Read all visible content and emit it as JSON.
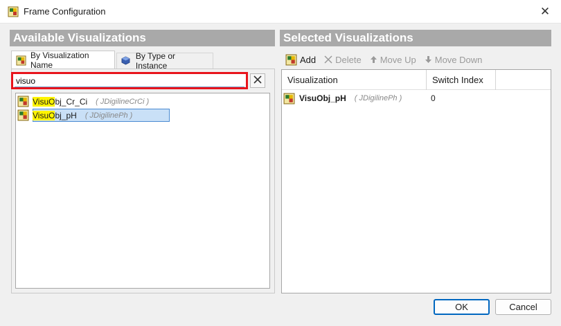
{
  "window": {
    "title": "Frame Configuration",
    "close_glyph": "✕"
  },
  "left_panel": {
    "header": "Available Visualizations",
    "tabs": [
      {
        "label": "By Visualization Name",
        "icon": "visu-object-icon",
        "active": true
      },
      {
        "label": "By Type or Instance",
        "icon": "cube-icon",
        "active": false
      }
    ],
    "search": {
      "value": "visuo",
      "placeholder": "",
      "clear_icon": "clear-x-icon"
    },
    "items": [
      {
        "match": "VisuO",
        "rest": "bj_Cr_Ci",
        "type": "( JDigilineCrCi )",
        "selected": false
      },
      {
        "match": "VisuO",
        "rest": "bj_pH",
        "type": "( JDigilinePh )",
        "selected": true
      }
    ]
  },
  "right_panel": {
    "header": "Selected Visualizations",
    "toolbar": {
      "add": "Add",
      "delete": "Delete",
      "move_up": "Move Up",
      "move_down": "Move Down"
    },
    "columns": [
      "Visualization",
      "Switch Index"
    ],
    "rows": [
      {
        "name": "VisuObj_pH",
        "type": "( JDigilinePh )",
        "switch_index": "0"
      }
    ]
  },
  "buttons": {
    "ok": "OK",
    "cancel": "Cancel"
  },
  "colors": {
    "header_bg": "#a9a9a9",
    "highlight": "#fff400",
    "selection": "#c9e0f7",
    "search_border": "#e8141c",
    "default_button": "#0067c0"
  }
}
